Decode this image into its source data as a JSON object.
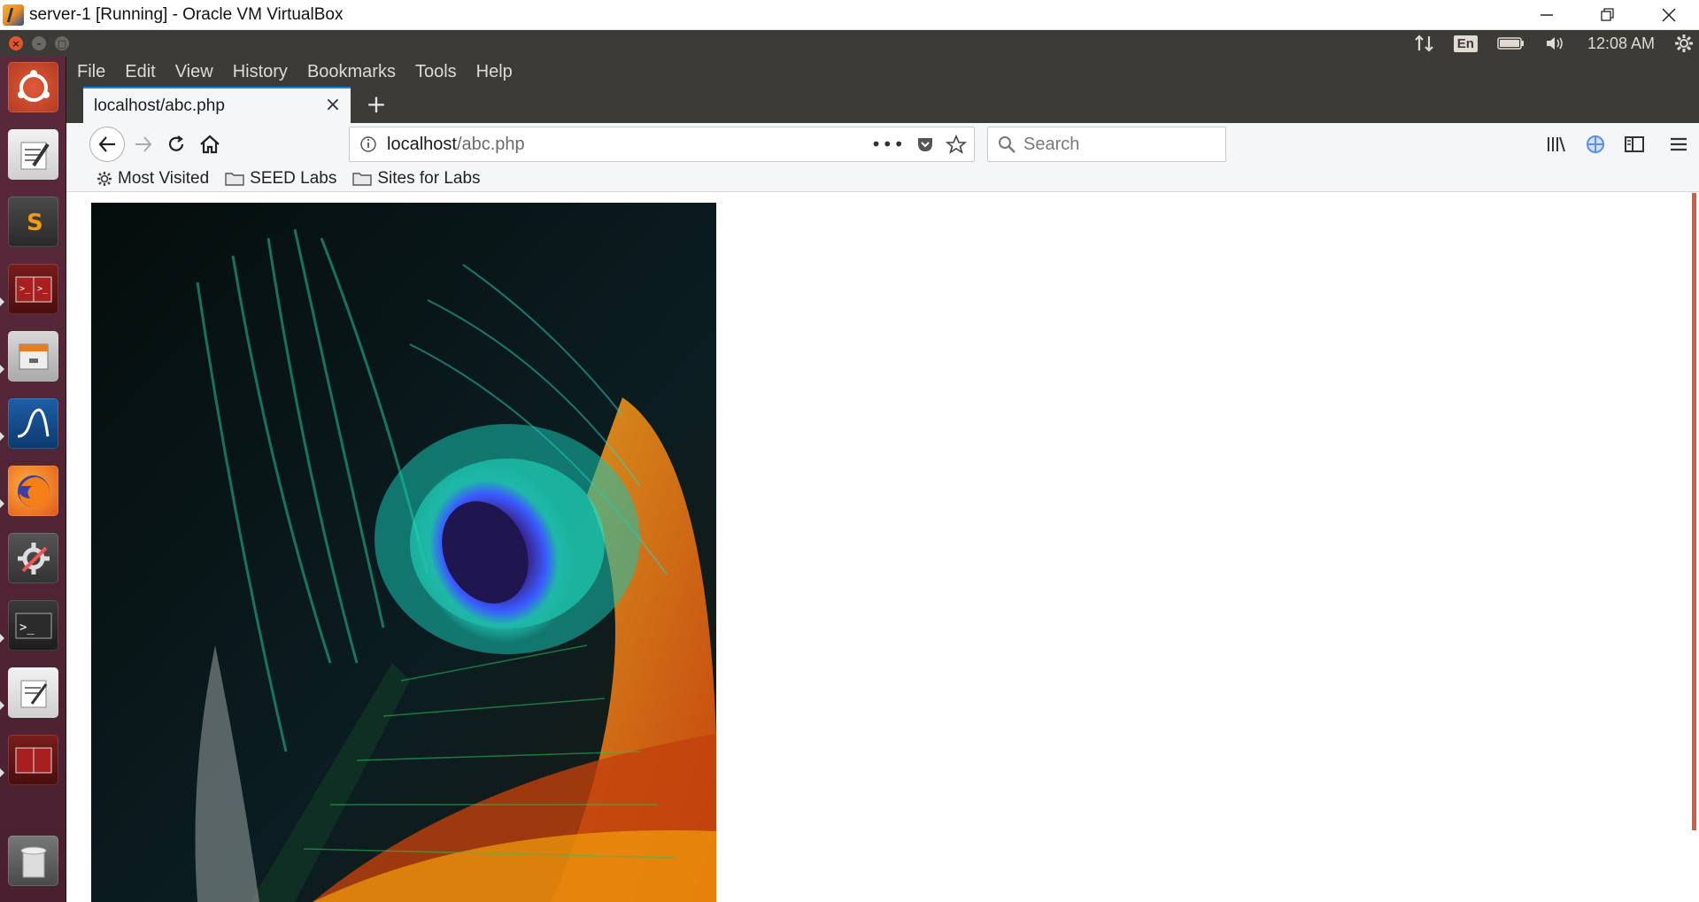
{
  "host_window": {
    "title": "server-1 [Running] - Oracle VM VirtualBox"
  },
  "ubuntu_panel": {
    "lang": "En",
    "time": "12:08 AM"
  },
  "menubar": {
    "items": [
      "File",
      "Edit",
      "View",
      "History",
      "Bookmarks",
      "Tools",
      "Help"
    ]
  },
  "tabs": [
    {
      "title": "localhost/abc.php"
    }
  ],
  "urlbar": {
    "host": "localhost",
    "path": "/abc.php"
  },
  "searchbar": {
    "placeholder": "Search"
  },
  "bookmarks": [
    {
      "label": "Most Visited",
      "icon": "gear-icon"
    },
    {
      "label": "SEED Labs",
      "icon": "folder-icon"
    },
    {
      "label": "Sites for Labs",
      "icon": "folder-icon"
    }
  ],
  "launcher": {
    "items": [
      "ubuntu-dash",
      "text-editor",
      "sublime-text",
      "terminal-red",
      "files",
      "wireshark",
      "firefox",
      "system-settings",
      "terminal",
      "text-editor-2",
      "terminal-red-2",
      "trash"
    ]
  },
  "colors": {
    "panel": "#3c3b37",
    "launcher": "#5a2a3c",
    "tab_accent": "#0a84ff"
  }
}
